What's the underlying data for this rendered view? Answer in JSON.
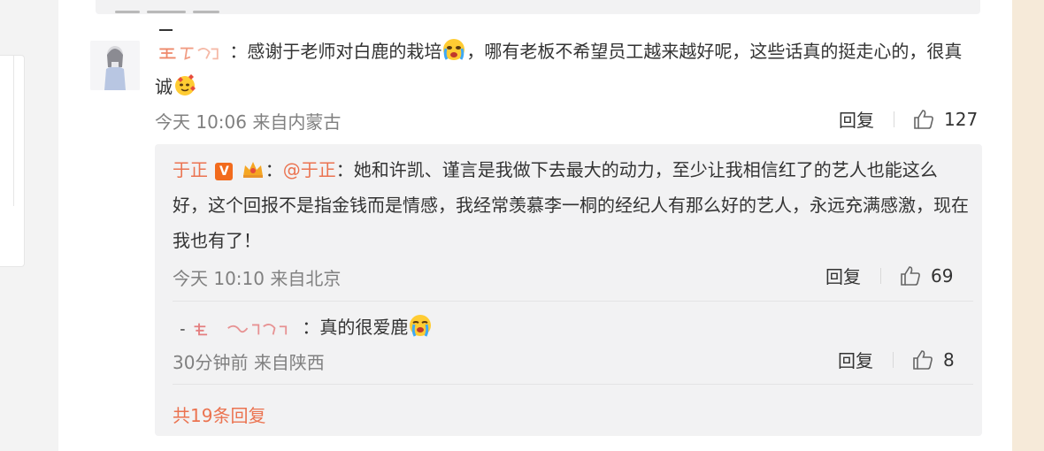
{
  "comments": [
    {
      "nick": "王丁心",
      "text_a": "：感谢于老师对白鹿的栽培",
      "text_b": "，哪有老板不希望员工越来越好呢，这些话真的挺走心的，很真诚",
      "time": "今天 10:06",
      "source": "来自内蒙古",
      "reply_label": "回复",
      "likes": "127",
      "emoji_a": "crying-emoji",
      "emoji_b": "love-emoji"
    }
  ],
  "replies": [
    {
      "nick": "于正",
      "badge": "V",
      "mention": "@于正",
      "text": "：她和许凯、谨言是我做下去最大的动力，至少让我相信红了的艺人也能这么好，这个回报不是指金钱而是情感，我经常羡慕李一桐的经纪人有那么好的艺人，永远充满感激，现在我也有了！",
      "time": "今天 10:10",
      "source": "来自北京",
      "reply_label": "回复",
      "likes": "69"
    },
    {
      "nick": "",
      "text": "：真的很爱鹿",
      "time": "30分钟前",
      "source": "来自陕西",
      "reply_label": "回复",
      "likes": "8",
      "emoji": "crying-emoji"
    }
  ],
  "more_replies": "共19条回复",
  "colors": {
    "accent": "#eb7350",
    "meta": "#808080",
    "subbox": "#f2f2f3",
    "right_gutter": "#f6ead9"
  },
  "icons": [
    "like-icon",
    "crown-icon",
    "verified-badge-icon"
  ]
}
